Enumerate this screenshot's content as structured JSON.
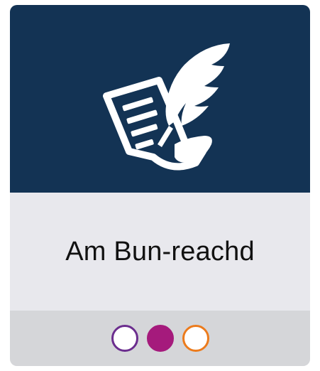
{
  "card": {
    "title": "Am Bun-reachd",
    "icon": "scroll-quill-icon",
    "colors": {
      "hero_background": "#133354",
      "title_background": "#e8e8ed",
      "footer_background": "#d5d6d9",
      "icon_color": "#ffffff"
    }
  },
  "indicators": [
    {
      "name": "indicator-purple",
      "style": "outline",
      "color": "#6b2d8e"
    },
    {
      "name": "indicator-magenta",
      "style": "filled",
      "color": "#a51a7c"
    },
    {
      "name": "indicator-orange",
      "style": "outline",
      "color": "#ec7b1c"
    }
  ]
}
